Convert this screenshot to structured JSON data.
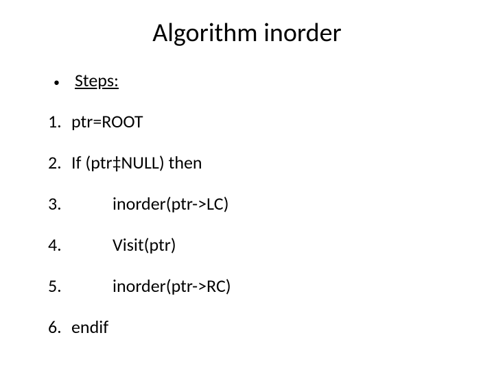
{
  "title": "Algorithm inorder",
  "stepsLabel": "Steps:",
  "items": [
    {
      "num": "1.",
      "text": "ptr=ROOT",
      "indent": false
    },
    {
      "num": "2.",
      "text": "If (ptr‡NULL) then",
      "indent": false
    },
    {
      "num": "3.",
      "text": "inorder(ptr->LC)",
      "indent": true
    },
    {
      "num": "4.",
      "text": "Visit(ptr)",
      "indent": true
    },
    {
      "num": "5.",
      "text": "inorder(ptr->RC)",
      "indent": true
    },
    {
      "num": "6.",
      "text": "endif",
      "indent": false
    }
  ]
}
